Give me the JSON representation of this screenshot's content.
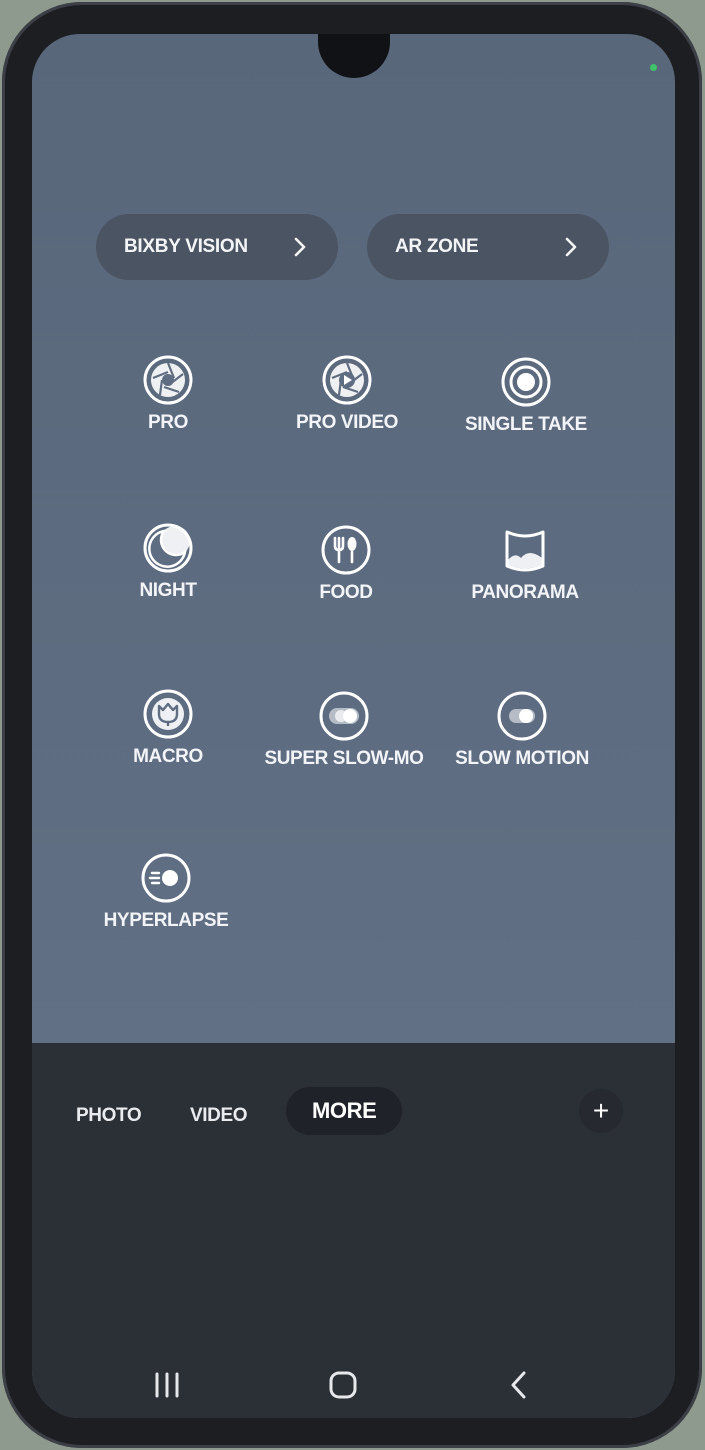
{
  "top_buttons": [
    {
      "label": "BIXBY VISION"
    },
    {
      "label": "AR ZONE"
    }
  ],
  "modes": [
    {
      "label": "PRO",
      "icon": "pro-aperture-icon"
    },
    {
      "label": "PRO VIDEO",
      "icon": "pro-video-icon"
    },
    {
      "label": "SINGLE TAKE",
      "icon": "single-take-icon"
    },
    {
      "label": "NIGHT",
      "icon": "night-moon-icon"
    },
    {
      "label": "FOOD",
      "icon": "food-icon"
    },
    {
      "label": "PANORAMA",
      "icon": "panorama-icon"
    },
    {
      "label": "MACRO",
      "icon": "macro-flower-icon"
    },
    {
      "label": "SUPER SLOW-MO",
      "icon": "super-slow-mo-icon"
    },
    {
      "label": "SLOW MOTION",
      "icon": "slow-motion-icon"
    },
    {
      "label": "HYPERLAPSE",
      "icon": "hyperlapse-icon"
    }
  ],
  "mode_tabs": [
    {
      "label": "PHOTO"
    },
    {
      "label": "VIDEO"
    },
    {
      "label": "MORE",
      "active": true
    }
  ],
  "add_label": "+",
  "nav_buttons": [
    "recent-apps-icon",
    "home-icon",
    "back-icon"
  ],
  "colors": {
    "screen_bg": "#5f6d82",
    "pill_bg": "#4a5462",
    "bottom_bar": "#2b2f36",
    "active_tab_bg": "#1f2228",
    "text": "#f2f4f7"
  }
}
